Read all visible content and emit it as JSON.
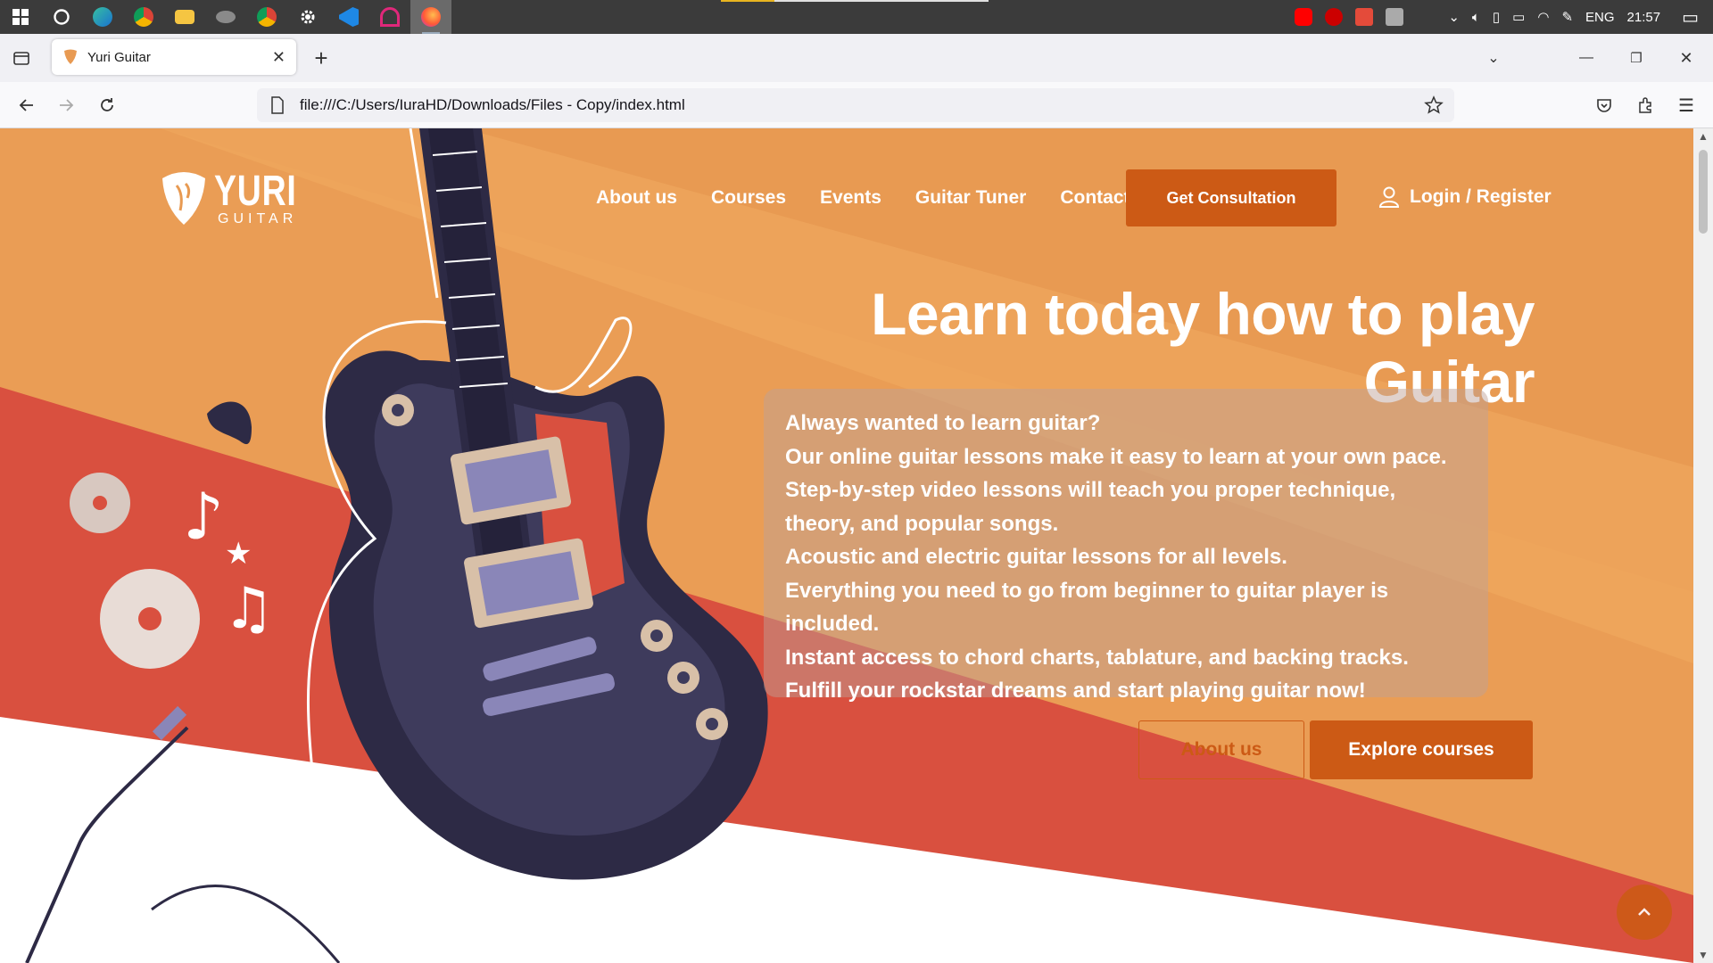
{
  "taskbar": {
    "clock": "21:57",
    "language": "ENG",
    "apps": [
      "windows-start",
      "search",
      "edge",
      "chrome",
      "file-explorer",
      "disk-app",
      "chrome-2",
      "settings",
      "vscode",
      "app-pink",
      "firefox"
    ]
  },
  "browser": {
    "tab_title": "Yuri Guitar",
    "url": "file:///C:/Users/IuraHD/Downloads/Files - Copy/index.html"
  },
  "site": {
    "logo": {
      "word": "YURI",
      "sub": "GUITAR"
    },
    "nav": [
      "About us",
      "Courses",
      "Events",
      "Guitar Tuner",
      "Contacts"
    ],
    "cta": "Get Consultation",
    "login": "Login / Register",
    "hero": {
      "title": "Learn today how to play Guitar",
      "lines": [
        "Always wanted to learn guitar?",
        "Our online guitar lessons make it easy to learn at your own pace.",
        "Step-by-step video lessons will teach you proper technique, theory, and popular songs.",
        "Acoustic and electric guitar lessons for all levels.",
        "Everything you need to go from beginner to guitar player is included.",
        "Instant access to chord charts, tablature, and backing tracks.",
        "Fulfill your rockstar dreams and start playing guitar now!"
      ],
      "btn_about": "About us",
      "btn_explore": "Explore courses"
    }
  },
  "colors": {
    "accent": "#cc5a15",
    "bg_orange": "#e89a52",
    "bg_red": "#d9503f",
    "guitar_dark": "#2d2a45"
  }
}
